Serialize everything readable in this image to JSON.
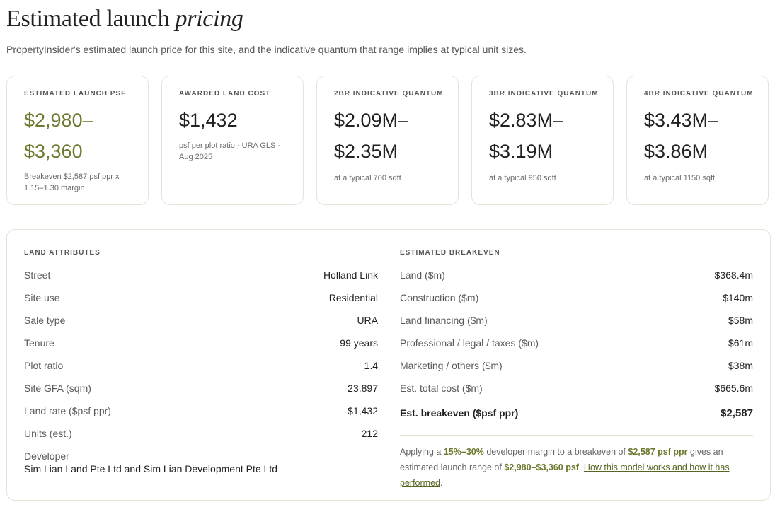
{
  "header": {
    "title": "Estimated launch",
    "title_emphasis": "pricing",
    "subtitle": "PropertyInsider's estimated launch price for this site, and the indicative quantum that range implies at typical unit sizes."
  },
  "cards": [
    {
      "label": "ESTIMATED LAUNCH PSF",
      "value_line1": "$2,980–",
      "value_line2": "$3,360",
      "note": "Breakeven $2,587 psf ppr x 1.15–1.30 margin"
    },
    {
      "label": "AWARDED LAND COST",
      "value_line1": "$1,432",
      "note": "psf per plot ratio · URA GLS · Aug 2025"
    },
    {
      "label": "2BR INDICATIVE QUANTUM",
      "value_line1": "$2.09M–",
      "value_line2": "$2.35M",
      "note": "at a typical 700 sqft"
    },
    {
      "label": "3BR INDICATIVE QUANTUM",
      "value_line1": "$2.83M–",
      "value_line2": "$3.19M",
      "note": "at a typical 950 sqft"
    },
    {
      "label": "4BR INDICATIVE QUANTUM",
      "value_line1": "$3.43M–",
      "value_line2": "$3.86M",
      "note": "at a typical 1150 sqft"
    }
  ],
  "land": {
    "label": "LAND ATTRIBUTES",
    "rows": [
      {
        "k": "Street",
        "v": "Holland Link"
      },
      {
        "k": "Site use",
        "v": "Residential"
      },
      {
        "k": "Sale type",
        "v": "URA"
      },
      {
        "k": "Tenure",
        "v": "99 years"
      },
      {
        "k": "Plot ratio",
        "v": "1.4"
      },
      {
        "k": "Site GFA (sqm)",
        "v": "23,897"
      },
      {
        "k": "Land rate ($psf ppr)",
        "v": "$1,432"
      },
      {
        "k": "Units (est.)",
        "v": "212"
      }
    ],
    "developer_label": "Developer",
    "developer_value": "Sim Lian Land Pte Ltd and Sim Lian Development Pte Ltd"
  },
  "breakeven": {
    "label": "ESTIMATED BREAKEVEN",
    "rows": [
      {
        "k": "Land ($m)",
        "v": "$368.4m"
      },
      {
        "k": "Construction ($m)",
        "v": "$140m"
      },
      {
        "k": "Land financing ($m)",
        "v": "$58m"
      },
      {
        "k": "Professional / legal / taxes ($m)",
        "v": "$61m"
      },
      {
        "k": "Marketing / others ($m)",
        "v": "$38m"
      },
      {
        "k": "Est. total cost ($m)",
        "v": "$665.6m"
      }
    ],
    "total": {
      "k": "Est. breakeven ($psf ppr)",
      "v": "$2,587"
    },
    "note": {
      "t1": "Applying a ",
      "margin": "15%–30%",
      "t2": " developer margin to a breakeven of ",
      "breakeven": "$2,587 psf ppr",
      "t3": " gives an estimated launch range of ",
      "range": "$2,980–$3,360 psf",
      "t4": ". ",
      "link": "How this model works and how it has performed",
      "t5": "."
    }
  },
  "colors": {
    "accent": "#6b7a2e",
    "border": "#e1e4d6",
    "link": "#556623"
  }
}
